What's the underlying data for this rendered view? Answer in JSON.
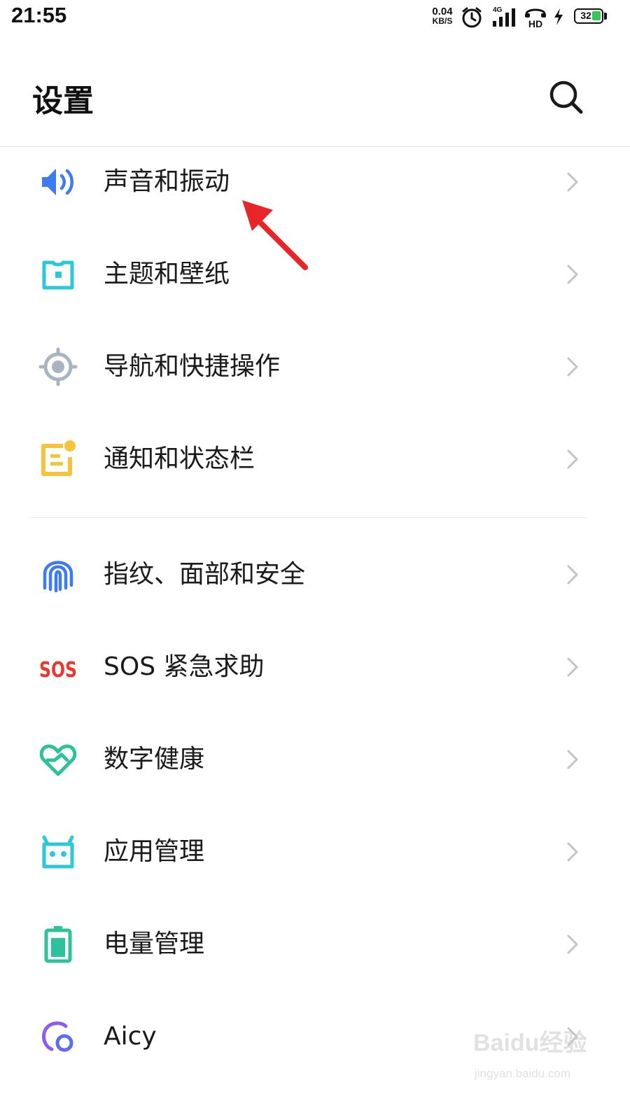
{
  "status_bar": {
    "time": "21:55",
    "net_speed_value": "0.04",
    "net_speed_unit": "KB/S",
    "network_type": "4G",
    "hd_label": "HD",
    "battery_level": "32",
    "icons": [
      "alarm-icon",
      "signal-icon",
      "hd-call-icon",
      "charging-icon",
      "battery-icon"
    ]
  },
  "header": {
    "title": "设置",
    "search_icon": "search-icon"
  },
  "settings": [
    {
      "label": "声音和振动",
      "icon": "sound-icon",
      "color": "#3d7cf0"
    },
    {
      "label": "主题和壁纸",
      "icon": "theme-icon",
      "color": "#2bc8d8"
    },
    {
      "label": "导航和快捷操作",
      "icon": "navigation-icon",
      "color": "#a9b4c3"
    },
    {
      "label": "通知和状态栏",
      "icon": "notification-icon",
      "color": "#f6c33b"
    },
    {
      "label": "指纹、面部和安全",
      "icon": "fingerprint-icon",
      "color": "#3d7cf0"
    },
    {
      "label": "SOS 紧急求助",
      "icon": "sos-icon",
      "color": "#e8392f",
      "icon_text": "SOS"
    },
    {
      "label": "数字健康",
      "icon": "digital-health-icon",
      "color": "#2cc29a"
    },
    {
      "label": "应用管理",
      "icon": "app-management-icon",
      "color": "#2bc8d8"
    },
    {
      "label": "电量管理",
      "icon": "battery-management-icon",
      "color": "#2cc29a"
    },
    {
      "label": "Aicy",
      "icon": "aicy-icon",
      "color": "#8a5cf5"
    }
  ],
  "watermark": {
    "logo": "Baidu经验",
    "url": "jingyan.baidu.com"
  }
}
